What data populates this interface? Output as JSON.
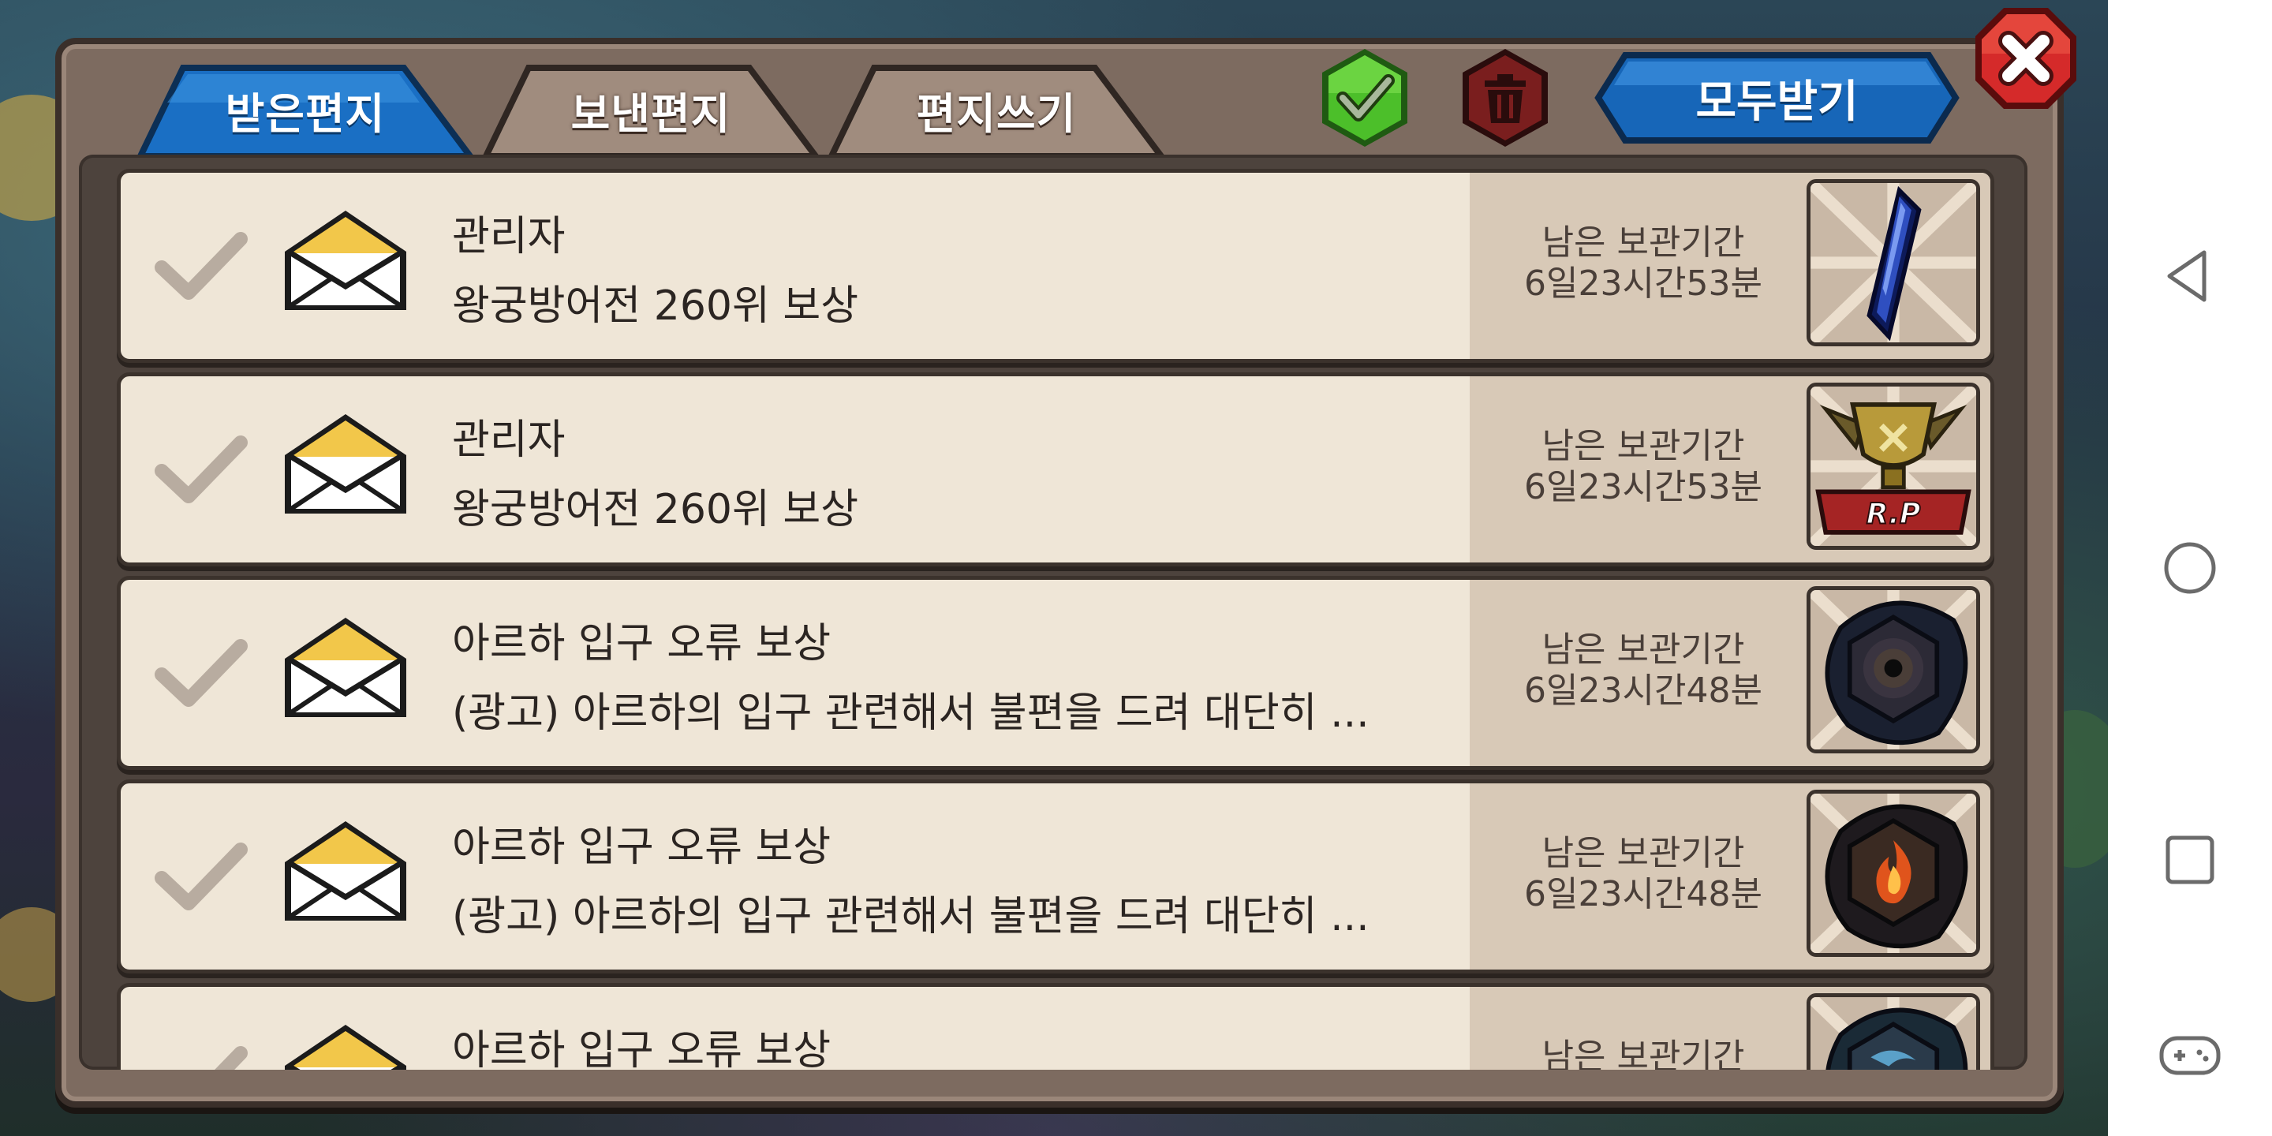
{
  "tabs": [
    {
      "label": "받은편지",
      "active": true
    },
    {
      "label": "보낸편지",
      "active": false
    },
    {
      "label": "편지쓰기",
      "active": false
    }
  ],
  "actions": {
    "select_all_icon": "green-check-icon",
    "delete_icon": "trash-icon",
    "receive_all_label": "모두받기",
    "close_icon": "close-icon"
  },
  "mails": [
    {
      "sender": "관리자",
      "subject": "왕궁방어전 260위 보상",
      "expiry_label": "남은 보관기간",
      "expiry_time": "6일23시간53분",
      "reward_icon": "blue-crystal-icon"
    },
    {
      "sender": "관리자",
      "subject": "왕궁방어전 260위 보상",
      "expiry_label": "남은 보관기간",
      "expiry_time": "6일23시간53분",
      "reward_icon": "rp-trophy-icon"
    },
    {
      "sender": "아르하 입구 오류 보상",
      "subject": "(광고) 아르하의 입구 관련해서 불편을 드려 대단히 ...",
      "expiry_label": "남은 보관기간",
      "expiry_time": "6일23시간48분",
      "reward_icon": "dark-eye-rune-icon"
    },
    {
      "sender": "아르하 입구 오류 보상",
      "subject": "(광고) 아르하의 입구 관련해서 불편을 드려 대단히 ...",
      "expiry_label": "남은 보관기간",
      "expiry_time": "6일23시간48분",
      "reward_icon": "fire-rune-icon"
    },
    {
      "sender": "아르하 입구 오류 보상",
      "subject": "",
      "expiry_label": "남은 보관기간",
      "expiry_time": "",
      "reward_icon": "water-rune-icon"
    }
  ],
  "system_nav": {
    "back_icon": "back-icon",
    "home_icon": "home-icon",
    "recents_icon": "recents-icon",
    "game_icon": "gamepad-icon"
  }
}
